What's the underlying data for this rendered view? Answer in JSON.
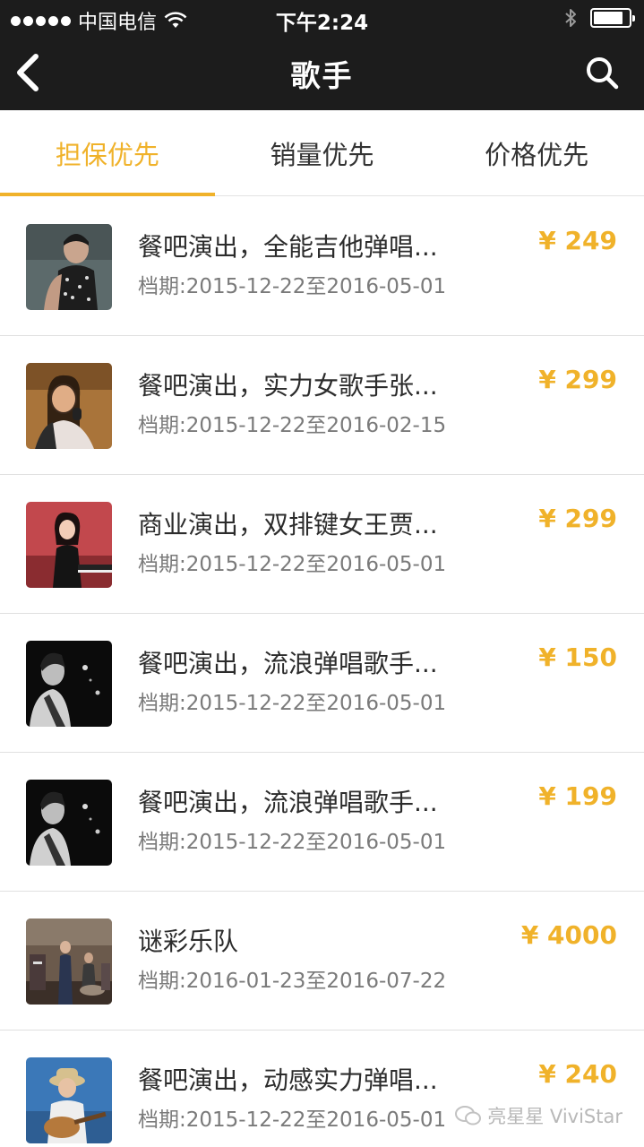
{
  "status_bar": {
    "carrier": "中国电信",
    "time": "下午2:24",
    "battery_level": 0.85
  },
  "nav": {
    "title": "歌手"
  },
  "tabs": [
    {
      "label": "担保优先",
      "active": true
    },
    {
      "label": "销量优先",
      "active": false
    },
    {
      "label": "价格优先",
      "active": false
    }
  ],
  "items": [
    {
      "title": "餐吧演出，全能吉他弹唱...",
      "dates": "档期:2015-12-22至2016-05-01",
      "price": "¥ 249"
    },
    {
      "title": "餐吧演出，实力女歌手张...",
      "dates": "档期:2015-12-22至2016-02-15",
      "price": "¥ 299"
    },
    {
      "title": "商业演出，双排键女王贾...",
      "dates": "档期:2015-12-22至2016-05-01",
      "price": "¥ 299"
    },
    {
      "title": "餐吧演出，流浪弹唱歌手...",
      "dates": "档期:2015-12-22至2016-05-01",
      "price": "¥ 150"
    },
    {
      "title": "餐吧演出，流浪弹唱歌手...",
      "dates": "档期:2015-12-22至2016-05-01",
      "price": "¥ 199"
    },
    {
      "title": "谜彩乐队",
      "dates": "档期:2016-01-23至2016-07-22",
      "price": "¥ 4000"
    },
    {
      "title": "餐吧演出，动感实力弹唱...",
      "dates": "档期:2015-12-22至2016-05-01",
      "price": "¥ 240"
    }
  ],
  "watermark": "亮星星 ViviStar",
  "colors": {
    "accent": "#f0b22a",
    "top_bar": "#1c1c1c"
  }
}
